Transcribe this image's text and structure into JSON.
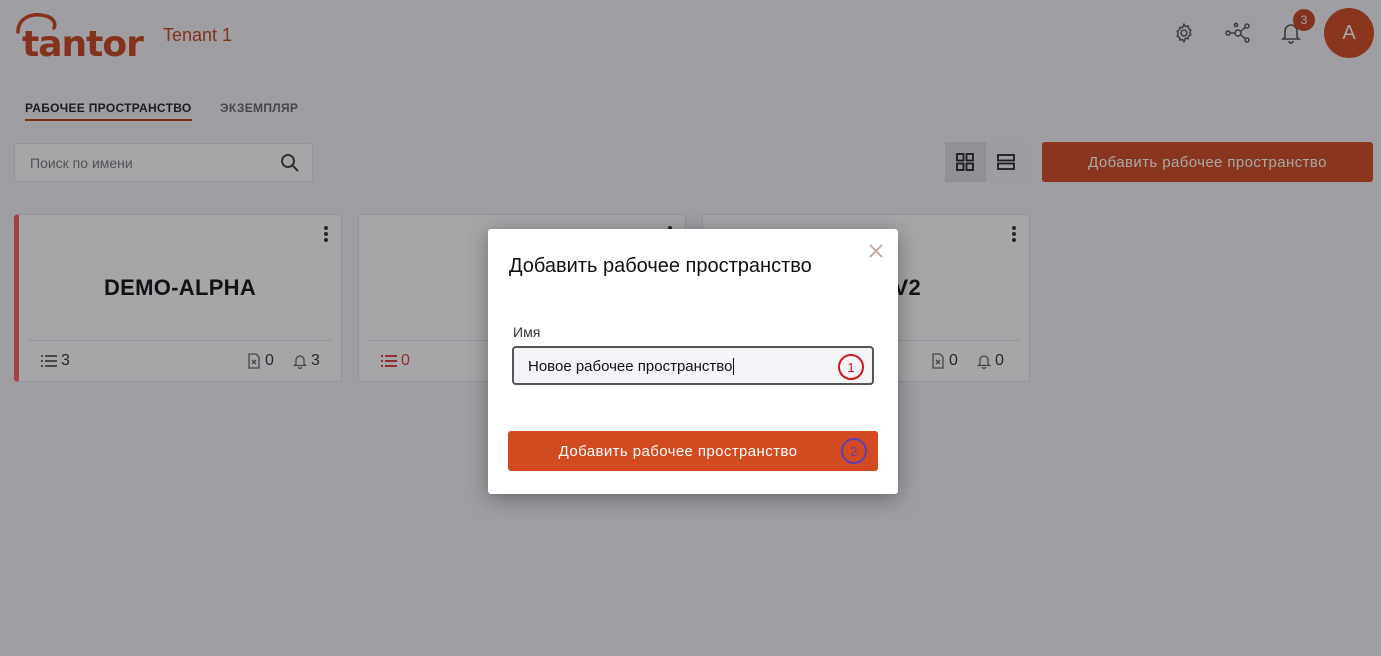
{
  "header": {
    "logo_text": "tantor",
    "tenant": "Tenant 1",
    "notification_count": "3",
    "avatar_initial": "A"
  },
  "tabs": [
    {
      "label": "РАБОЧЕЕ ПРОСТРАНСТВО",
      "active": true
    },
    {
      "label": "ЭКЗЕМПЛЯР",
      "active": false
    }
  ],
  "toolbar": {
    "search_placeholder": "Поиск по имени",
    "add_button": "Добавить рабочее пространство"
  },
  "cards": [
    {
      "title": "DEMO-ALPHA",
      "list_count": "3",
      "files_count": "0",
      "alerts_count": "3"
    },
    {
      "title": "",
      "list_count": "0",
      "files_count": "",
      "alerts_count": ""
    },
    {
      "title": "V2",
      "list_count": "",
      "files_count": "0",
      "alerts_count": "0"
    }
  ],
  "modal": {
    "title": "Добавить рабочее пространство",
    "field_label": "Имя",
    "field_value": "Новое рабочее пространство",
    "submit_button": "Добавить рабочее пространство",
    "marker_1": "1",
    "marker_2": "2"
  },
  "colors": {
    "accent": "#d24a1f",
    "marker_red": "#d01818",
    "marker_purple": "#5a3fb6"
  }
}
